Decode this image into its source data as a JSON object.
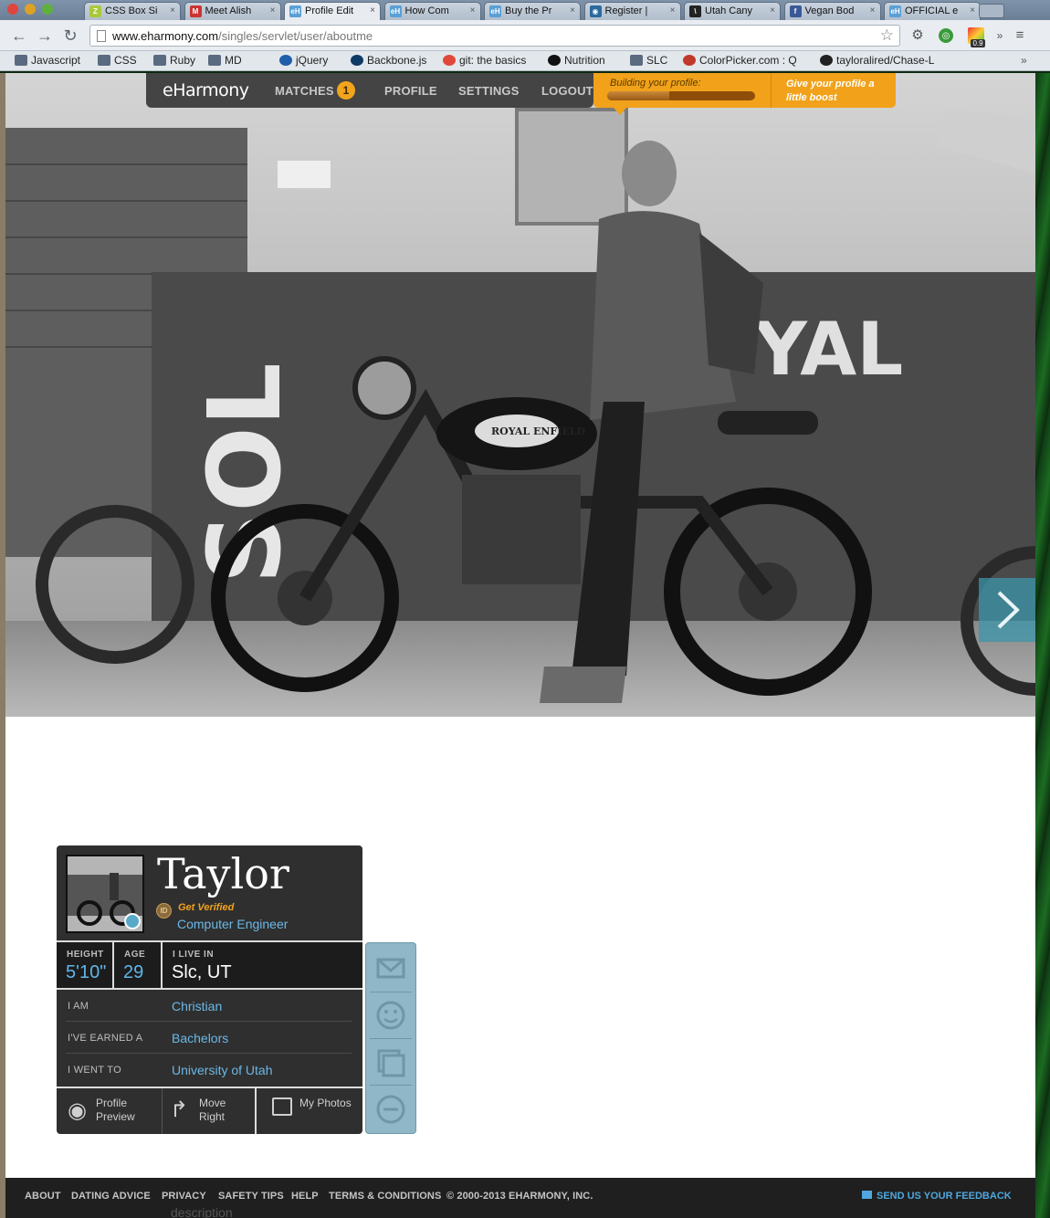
{
  "browser": {
    "tabs": [
      {
        "label": "CSS Box Si",
        "fav": "zebra-icon",
        "color": "#a9c93b",
        "favtext": "Z"
      },
      {
        "label": "Meet Alish",
        "fav": "gmail-icon",
        "color": "#c33",
        "favtext": "M"
      },
      {
        "label": "Profile Edit",
        "fav": "eharmony-icon",
        "color": "#5aa0d6",
        "favtext": "eH"
      },
      {
        "label": "How Com",
        "fav": "eharmony-icon",
        "color": "#5aa0d6",
        "favtext": "eH"
      },
      {
        "label": "Buy the Pr",
        "fav": "eharmony-icon",
        "color": "#5aa0d6",
        "favtext": "eH"
      },
      {
        "label": "Register |",
        "fav": "globe-icon",
        "color": "#2a6a9e",
        "favtext": "◉"
      },
      {
        "label": "Utah Cany",
        "fav": "slash-icon",
        "color": "#222",
        "favtext": "\\"
      },
      {
        "label": "Vegan Bod",
        "fav": "facebook-icon",
        "color": "#3b5998",
        "favtext": "f"
      },
      {
        "label": "OFFICIAL e",
        "fav": "eharmony-icon",
        "color": "#5aa0d6",
        "favtext": "eH"
      }
    ],
    "active_tab": 2,
    "url_domain": "www.eharmony.com",
    "url_path": "/singles/servlet/user/aboutme",
    "extension_badge": "0.9",
    "bookmarks": [
      {
        "label": "Javascript",
        "icon": "folder-icon"
      },
      {
        "label": "CSS",
        "icon": "folder-icon"
      },
      {
        "label": "Ruby",
        "icon": "folder-icon"
      },
      {
        "label": "MD",
        "icon": "folder-icon"
      },
      {
        "label": "jQuery",
        "icon": "jquery-icon"
      },
      {
        "label": "Backbone.js",
        "icon": "backbone-icon"
      },
      {
        "label": "git: the basics",
        "icon": "git-icon"
      },
      {
        "label": "Nutrition",
        "icon": "nd-icon"
      },
      {
        "label": "SLC",
        "icon": "folder-icon"
      },
      {
        "label": "ColorPicker.com : Q",
        "icon": "colorpicker-icon"
      },
      {
        "label": "tayloralired/Chase-L",
        "icon": "github-icon"
      }
    ]
  },
  "eh_nav": {
    "logo": "eHarmony",
    "matches": "MATCHES",
    "matches_count": "1",
    "profile": "PROFILE",
    "settings": "SETTINGS",
    "logout": "LOGOUT",
    "progress_label": "Building your profile:",
    "progress_fraction": 0.42,
    "boost": "Give your profile a little boost"
  },
  "profile": {
    "name": "Taylor",
    "get_verified": "Get Verified",
    "occupation": "Computer Engineer",
    "height_label": "HEIGHT",
    "height": "5'10\"",
    "age_label": "AGE",
    "age": "29",
    "live_label": "I LIVE IN",
    "live": "Slc, UT",
    "i_am_label": "I AM",
    "i_am": "Christian",
    "earned_label": "I'VE EARNED A",
    "earned": "Bachelors",
    "went_label": "I WENT TO",
    "went": "University of Utah",
    "preview": "Profile Preview",
    "move": "Move Right",
    "photos": "My Photos"
  },
  "footer": {
    "links": [
      "ABOUT",
      "DATING ADVICE",
      "PRIVACY",
      "SAFETY TIPS",
      "HELP",
      "TERMS & CONDITIONS"
    ],
    "copyright": "© 2000-2013 EHARMONY, INC.",
    "feedback": "SEND US YOUR FEEDBACK",
    "below_text": "description"
  },
  "colors": {
    "accent": "#f1a21a",
    "link": "#6ab8e8",
    "card": "#2f2f2f"
  }
}
